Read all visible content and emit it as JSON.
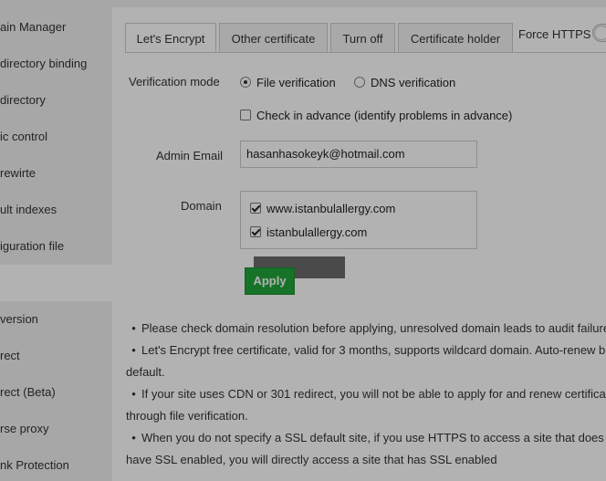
{
  "sidebar": {
    "items": [
      {
        "label": "ain Manager"
      },
      {
        "label": "directory binding"
      },
      {
        "label": "directory"
      },
      {
        "label": "ic control"
      },
      {
        "label": "rewirte"
      },
      {
        "label": "ult indexes"
      },
      {
        "label": "iguration file"
      },
      {
        "label": "version"
      },
      {
        "label": "rect"
      },
      {
        "label": "rect (Beta)"
      },
      {
        "label": "rse proxy"
      },
      {
        "label": "nk Protection"
      }
    ]
  },
  "tabs": [
    {
      "label": "Let's Encrypt",
      "active": true
    },
    {
      "label": "Other certificate"
    },
    {
      "label": "Turn off"
    },
    {
      "label": "Certificate holder"
    }
  ],
  "force_https": {
    "label": "Force HTTPS",
    "enabled": false
  },
  "verification": {
    "label": "Verification mode",
    "options": [
      {
        "label": "File verification",
        "selected": true
      },
      {
        "label": "DNS verification",
        "selected": false
      }
    ],
    "check_advance": {
      "label": "Check in advance (identify problems in advance)",
      "checked": false
    }
  },
  "admin_email": {
    "label": "Admin Email",
    "value": "hasanhasokeyk@hotmail.com"
  },
  "domain": {
    "label": "Domain",
    "items": [
      {
        "label": "www.istanbulallergy.com",
        "checked": true
      },
      {
        "label": "istanbulallergy.com",
        "checked": true
      }
    ]
  },
  "apply_label": "Apply",
  "notes": [
    "Please check domain resolution before applying, unresolved domain leads to audit failure",
    "Let's Encrypt free certificate, valid for 3 months, supports wildcard domain. Auto-renew b",
    "default.",
    "If your site uses CDN or 301 redirect, you will not be able to apply for and renew certifica",
    "through file verification.",
    "When you do not specify a SSL default site, if you use HTTPS to access a site that does no",
    "have SSL enabled, you will directly access a site that has SSL enabled"
  ],
  "colors": {
    "accent": "#20a53a",
    "overlay": "rgba(0,0,0,0.30)"
  }
}
